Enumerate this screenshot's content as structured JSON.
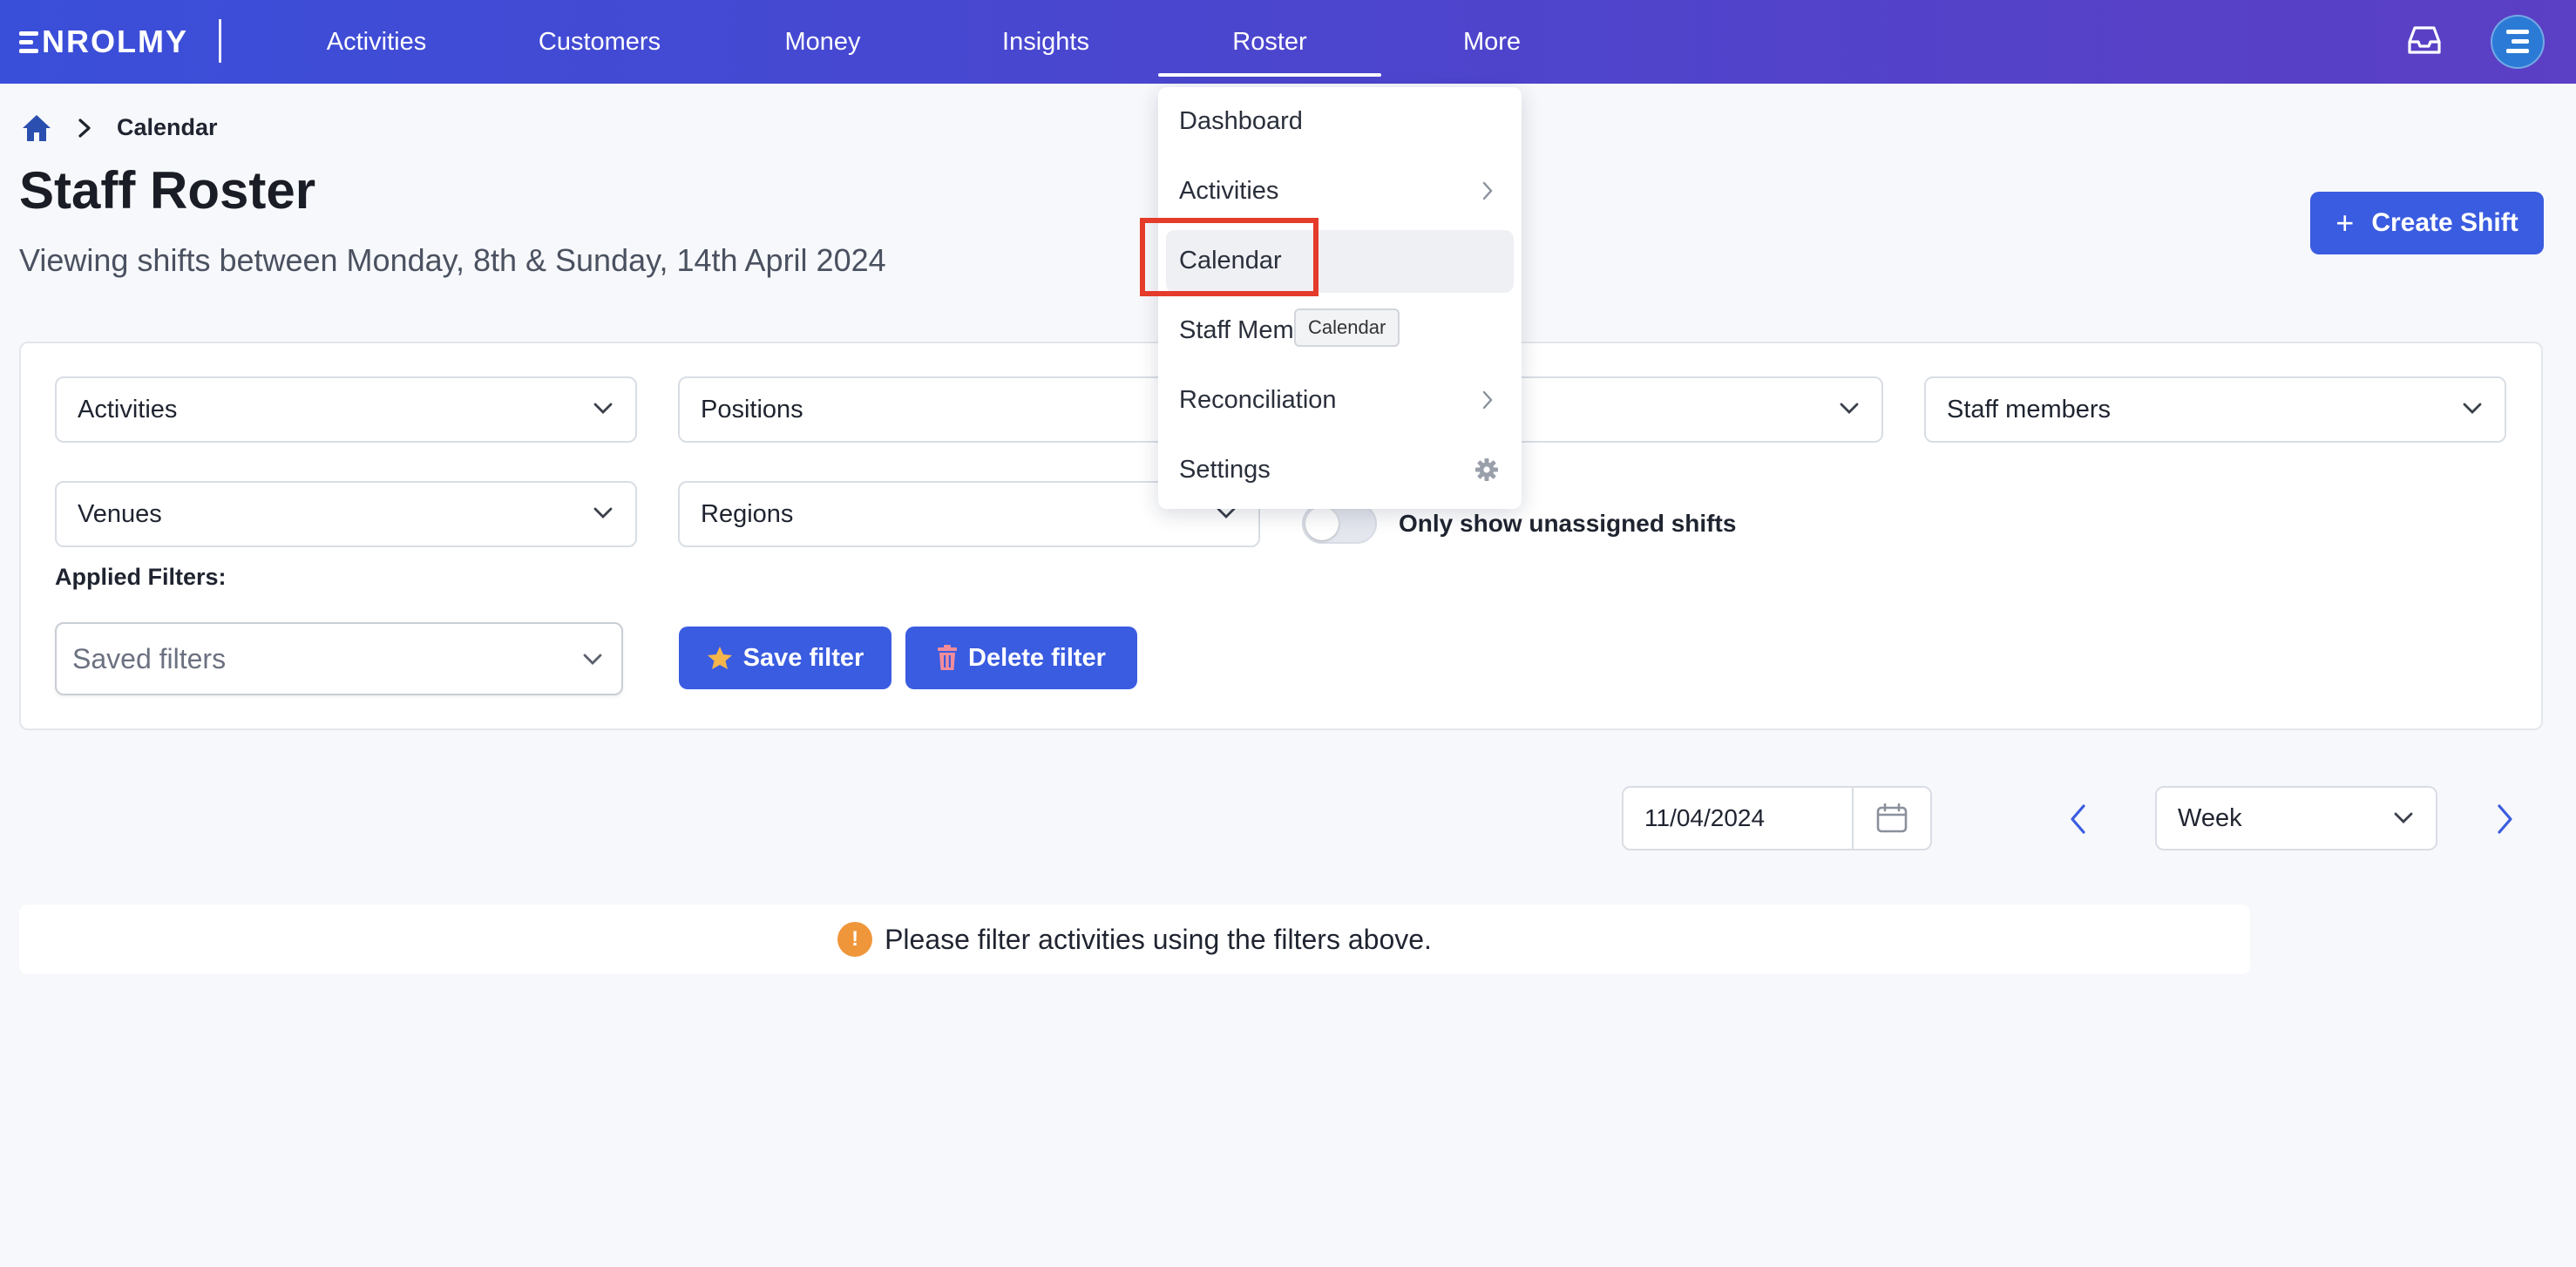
{
  "brand": {
    "name": "NROLMY"
  },
  "nav": {
    "items": [
      {
        "label": "Activities"
      },
      {
        "label": "Customers"
      },
      {
        "label": "Money"
      },
      {
        "label": "Insights"
      },
      {
        "label": "Roster"
      },
      {
        "label": "More"
      }
    ],
    "active": "Roster"
  },
  "breadcrumb": {
    "current": "Calendar"
  },
  "page": {
    "title": "Staff Roster",
    "subtitle": "Viewing shifts between Monday, 8th & Sunday, 14th April 2024",
    "create_button": "Create Shift"
  },
  "filters": {
    "row1": [
      "Activities",
      "Positions",
      "",
      "Staff members"
    ],
    "row2": [
      "Venues",
      "Regions"
    ],
    "toggle_label": "Only show unassigned shifts",
    "toggle_on": false,
    "applied_label": "Applied Filters:",
    "saved_placeholder": "Saved filters",
    "save_button": "Save filter",
    "delete_button": "Delete filter"
  },
  "date_controls": {
    "date": "11/04/2024",
    "view": "Week"
  },
  "notice": {
    "text": "Please filter activities using the filters above."
  },
  "roster_menu": {
    "items": [
      {
        "label": "Dashboard",
        "submenu": false
      },
      {
        "label": "Activities",
        "submenu": true
      },
      {
        "label": "Calendar",
        "submenu": false
      },
      {
        "label": "Staff Mem",
        "submenu": false
      },
      {
        "label": "Reconciliation",
        "submenu": true
      },
      {
        "label": "Settings",
        "submenu": false
      }
    ],
    "tooltip": "Calendar"
  },
  "colors": {
    "primary": "#3a5ce0",
    "nav_start": "#3a4fd9",
    "nav_end": "#5b3fc4",
    "highlight": "#e53b2a",
    "warning": "#f0963a",
    "delete_icon": "#f28c9a",
    "star_icon": "#f6b54a"
  },
  "icons": {
    "home": "home-icon",
    "inbox": "inbox-icon",
    "avatar": "avatar",
    "calendar": "calendar-icon",
    "star": "star-icon",
    "trash": "trash-icon",
    "gear": "gear-icon",
    "warning": "warning-icon"
  }
}
